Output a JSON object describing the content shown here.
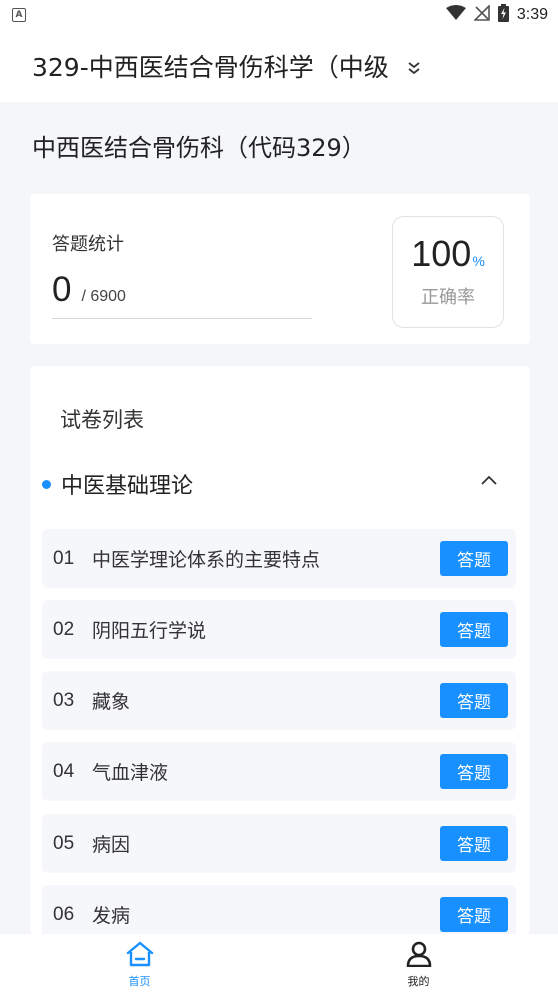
{
  "status_bar": {
    "time": "3:39",
    "left_icon": "a-notification-icon",
    "icons": [
      "wifi-icon",
      "no-signal-icon",
      "battery-charging-icon"
    ]
  },
  "header": {
    "title": "329-中西医结合骨伤科学（中级",
    "expand_icon": "double-chevron-down-icon"
  },
  "subject": {
    "title": "中西医结合骨伤科（代码329）"
  },
  "stats": {
    "label": "答题统计",
    "answered": "0",
    "total": "/ 6900",
    "accuracy_value": "100",
    "accuracy_unit": "%",
    "accuracy_label": "正确率"
  },
  "paper_list": {
    "title": "试卷列表",
    "section": {
      "name": "中医基础理论",
      "expanded": true
    },
    "chapters": [
      {
        "num": "01",
        "name": "中医学理论体系的主要特点",
        "action": "答题"
      },
      {
        "num": "02",
        "name": "阴阳五行学说",
        "action": "答题"
      },
      {
        "num": "03",
        "name": "藏象",
        "action": "答题"
      },
      {
        "num": "04",
        "name": "气血津液",
        "action": "答题"
      },
      {
        "num": "05",
        "name": "病因",
        "action": "答题"
      },
      {
        "num": "06",
        "name": "发病",
        "action": "答题"
      }
    ]
  },
  "bottom_nav": {
    "items": [
      {
        "label": "首页",
        "icon": "home-icon",
        "active": true
      },
      {
        "label": "我的",
        "icon": "user-icon",
        "active": false
      }
    ]
  },
  "colors": {
    "accent": "#1890ff",
    "background": "#f4f6fa",
    "card": "#ffffff",
    "row": "#f6f7fb"
  }
}
